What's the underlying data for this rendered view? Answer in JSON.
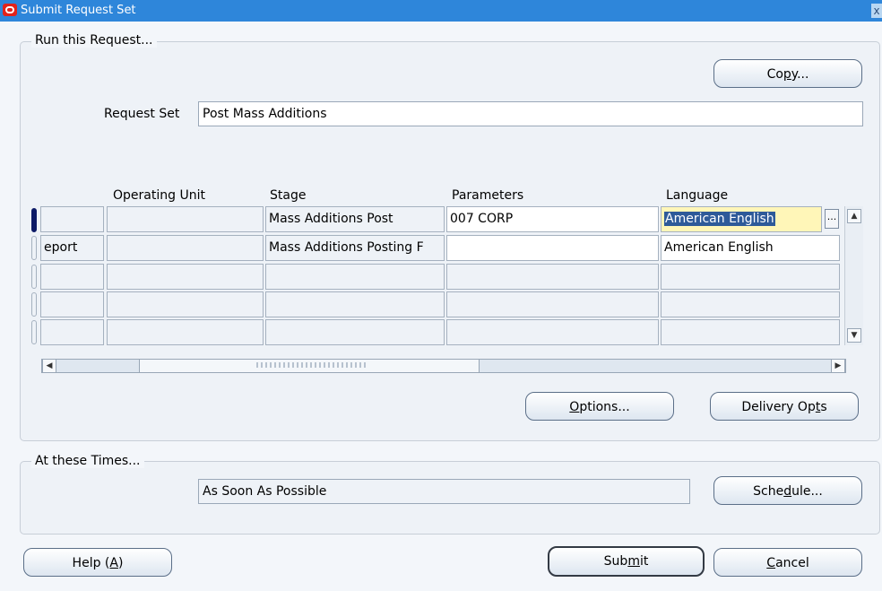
{
  "window": {
    "title": "Submit Request Set",
    "close_glyph": "x"
  },
  "run_group": {
    "legend": "Run this Request...",
    "copy_button": {
      "label_pre": "Co",
      "label_key": "p",
      "label_post": "y..."
    },
    "request_set_label": "Request Set",
    "request_set_value": "Post Mass Additions"
  },
  "grid": {
    "columns": {
      "operating_unit": "Operating Unit",
      "stage": "Stage",
      "parameters": "Parameters",
      "language": "Language"
    },
    "rows": [
      {
        "first": "",
        "operating_unit": "",
        "stage": "Mass Additions Post",
        "parameters": "007 CORP",
        "language": "American English"
      },
      {
        "first": "eport",
        "operating_unit": "",
        "stage": "Mass Additions Posting F",
        "parameters": "",
        "language": "American English"
      },
      {
        "first": "",
        "operating_unit": "",
        "stage": "",
        "parameters": "",
        "language": ""
      },
      {
        "first": "",
        "operating_unit": "",
        "stage": "",
        "parameters": "",
        "language": ""
      },
      {
        "first": "",
        "operating_unit": "",
        "stage": "",
        "parameters": "",
        "language": ""
      }
    ],
    "lov_glyph": "...",
    "scroll_up_icon": "triangle-up-icon",
    "scroll_down_icon": "triangle-down-icon",
    "scroll_left_icon": "triangle-left-icon",
    "scroll_right_icon": "triangle-right-icon"
  },
  "options_button": {
    "key": "O",
    "rest": "ptions..."
  },
  "delivery_button": {
    "pre": "Delivery Op",
    "key": "t",
    "post": "s"
  },
  "times_group": {
    "legend": "At these Times...",
    "value": "As Soon As Possible",
    "schedule_button": {
      "pre": "Sche",
      "key": "d",
      "post": "ule..."
    }
  },
  "footer": {
    "help_button": {
      "pre": "Help (",
      "key": "A",
      "post": ")"
    },
    "submit_button": {
      "pre": "Sub",
      "key": "m",
      "post": "it"
    },
    "cancel_button": {
      "key": "C",
      "post": "ancel"
    }
  }
}
